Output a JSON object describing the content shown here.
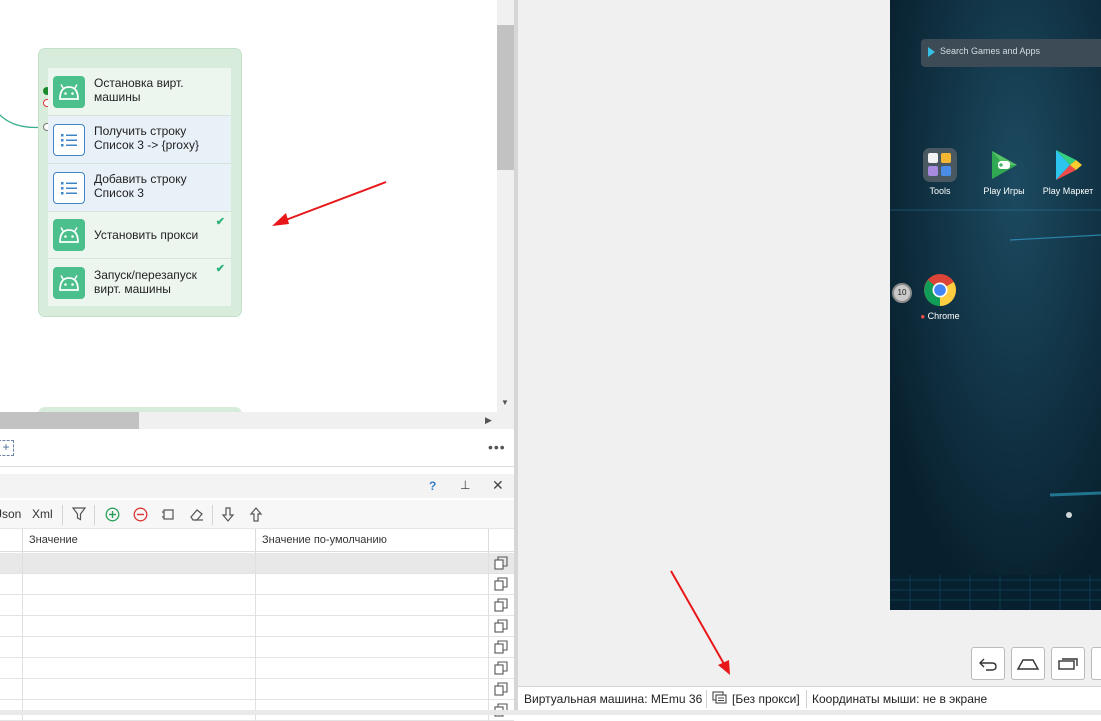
{
  "canvas": {
    "blocks": [
      {
        "label": "Остановка вирт.\nмашины",
        "kind": "android",
        "checked": false
      },
      {
        "label": "Получить строку\nСписок 3 -> {proxy}",
        "kind": "list",
        "checked": false
      },
      {
        "label": "Добавить строку\nСписок 3",
        "kind": "list",
        "checked": false
      },
      {
        "label": "Установить прокси",
        "kind": "android",
        "checked": true
      },
      {
        "label": "Запуск/перезапуск\nвирт. машины",
        "kind": "android",
        "checked": true
      }
    ],
    "check_mark": "✔"
  },
  "canvas_toolbar": {
    "add_icon": "+",
    "more_icon": "•••"
  },
  "panel": {
    "help": "?",
    "pin": "⊥",
    "close": "✕",
    "toolbar": {
      "json": "Json",
      "xml": "Xml"
    },
    "columns": [
      "Значение",
      "Значение по-умолчанию"
    ],
    "row_count": 8
  },
  "emulator": {
    "search_placeholder": "Search Games and Apps",
    "apps": [
      {
        "label": "Tools",
        "icon": "tools-folder-icon"
      },
      {
        "label": "Play Игры",
        "icon": "play-games-icon"
      },
      {
        "label": "Play Маркет",
        "icon": "play-market-icon"
      },
      {
        "label": "Chrome",
        "icon": "chrome-icon"
      }
    ],
    "badge": "10"
  },
  "statusbar": {
    "vm": "Виртуальная машина: MEmu 36",
    "proxy": "[Без прокси]",
    "mouse": "Координаты мыши: не в экране"
  },
  "colors": {
    "group_bg": "#d8ecdc",
    "android_icon": "#4cc08c",
    "list_icon_border": "#3f86c9",
    "arrow": "#e8171a",
    "connector": "#3aae8e"
  }
}
